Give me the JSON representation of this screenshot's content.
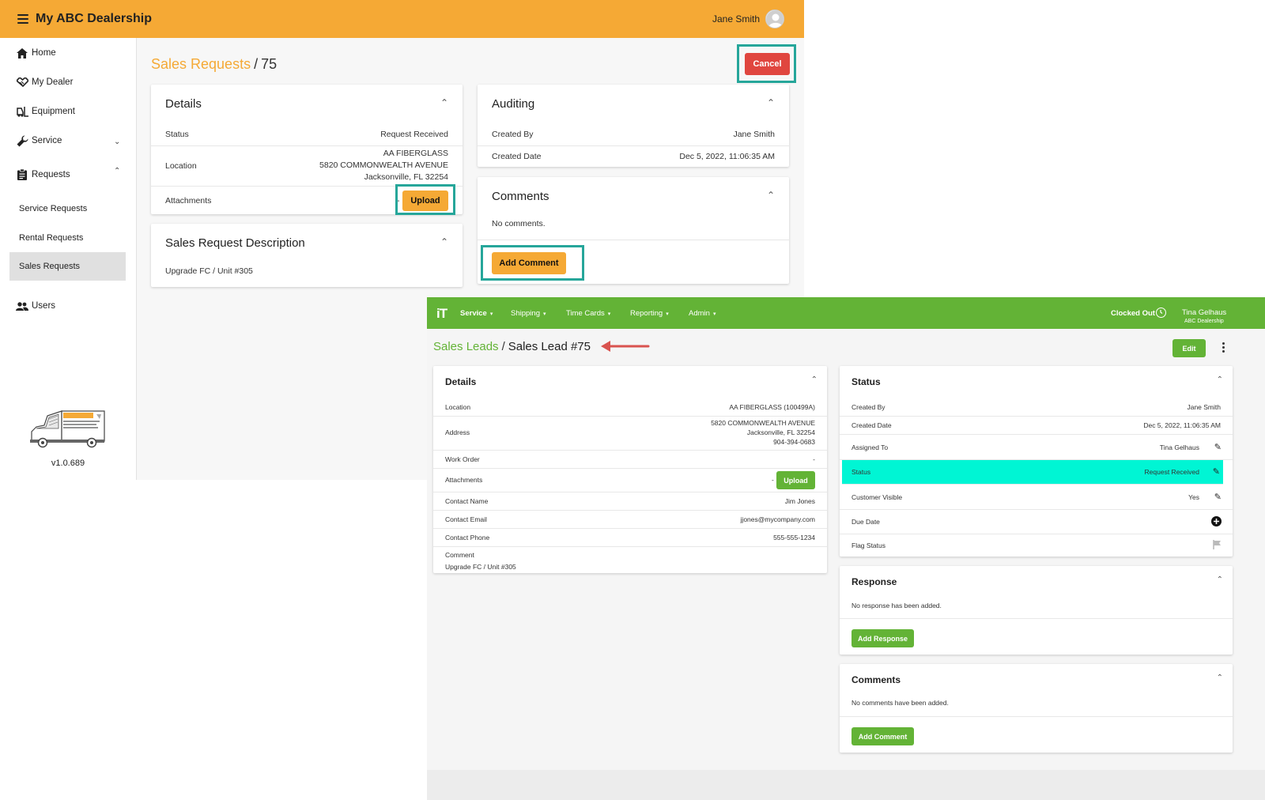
{
  "portal": {
    "app_title": "My ABC Dealership",
    "user_name": "Jane Smith",
    "nav": {
      "home": "Home",
      "my_dealer": "My Dealer",
      "equipment": "Equipment",
      "service": "Service",
      "requests": "Requests",
      "service_requests": "Service Requests",
      "rental_requests": "Rental Requests",
      "sales_requests": "Sales Requests",
      "users": "Users"
    },
    "version": "v1.0.689",
    "breadcrumb": {
      "parent": "Sales Requests",
      "separator": "/",
      "current": "75"
    },
    "cancel_label": "Cancel",
    "details": {
      "title": "Details",
      "status_label": "Status",
      "status_value": "Request Received",
      "location_label": "Location",
      "location_line1": "AA FIBERGLASS",
      "location_line2": "5820 COMMONWEALTH AVENUE",
      "location_line3": "Jacksonville, FL 32254",
      "attachments_label": "Attachments",
      "attachments_value": "-",
      "upload_label": "Upload"
    },
    "description": {
      "title": "Sales Request Description",
      "text": "Upgrade FC / Unit #305"
    },
    "auditing": {
      "title": "Auditing",
      "created_by_label": "Created By",
      "created_by_value": "Jane Smith",
      "created_date_label": "Created Date",
      "created_date_value": "Dec 5, 2022, 11:06:35 AM"
    },
    "comments": {
      "title": "Comments",
      "empty_text": "No comments.",
      "add_label": "Add Comment"
    }
  },
  "itapp": {
    "logo": "iT",
    "menu": {
      "service": "Service",
      "shipping": "Shipping",
      "time_cards": "Time Cards",
      "reporting": "Reporting",
      "admin": "Admin"
    },
    "clock_status": "Clocked Out",
    "user_name": "Tina Gelhaus",
    "user_org": "ABC Dealership",
    "breadcrumb": {
      "parent": "Sales Leads",
      "separator": "/",
      "current": "Sales Lead #75"
    },
    "edit_label": "Edit",
    "details": {
      "title": "Details",
      "location_label": "Location",
      "location_value": "AA FIBERGLASS (100499A)",
      "address_label": "Address",
      "address_line1": "5820 COMMONWEALTH AVENUE",
      "address_line2": "Jacksonville, FL 32254",
      "address_line3": "904-394-0683",
      "work_order_label": "Work Order",
      "work_order_value": "-",
      "attachments_label": "Attachments",
      "attachments_value": "-",
      "upload_label": "Upload",
      "contact_name_label": "Contact Name",
      "contact_name_value": "Jim Jones",
      "contact_email_label": "Contact Email",
      "contact_email_value": "jjones@mycompany.com",
      "contact_phone_label": "Contact Phone",
      "contact_phone_value": "555-555-1234",
      "comment_label": "Comment",
      "comment_value": "Upgrade FC / Unit #305"
    },
    "status": {
      "title": "Status",
      "created_by_label": "Created By",
      "created_by_value": "Jane Smith",
      "created_date_label": "Created Date",
      "created_date_value": "Dec 5, 2022, 11:06:35 AM",
      "assigned_to_label": "Assigned To",
      "assigned_to_value": "Tina Gelhaus",
      "status_label": "Status",
      "status_value": "Request Received",
      "customer_visible_label": "Customer Visible",
      "customer_visible_value": "Yes",
      "due_date_label": "Due Date",
      "flag_status_label": "Flag Status"
    },
    "response": {
      "title": "Response",
      "empty_text": "No response has been added.",
      "add_label": "Add Response"
    },
    "comments": {
      "title": "Comments",
      "empty_text": "No comments have been added.",
      "add_label": "Add Comment"
    }
  },
  "colors": {
    "portal_accent": "#f5a935",
    "cancel_red": "#e0463f",
    "highlight_teal": "#26a69a",
    "it_green": "#63b336",
    "status_highlight": "#00f5d4",
    "annotation_arrow": "#d9534f"
  }
}
